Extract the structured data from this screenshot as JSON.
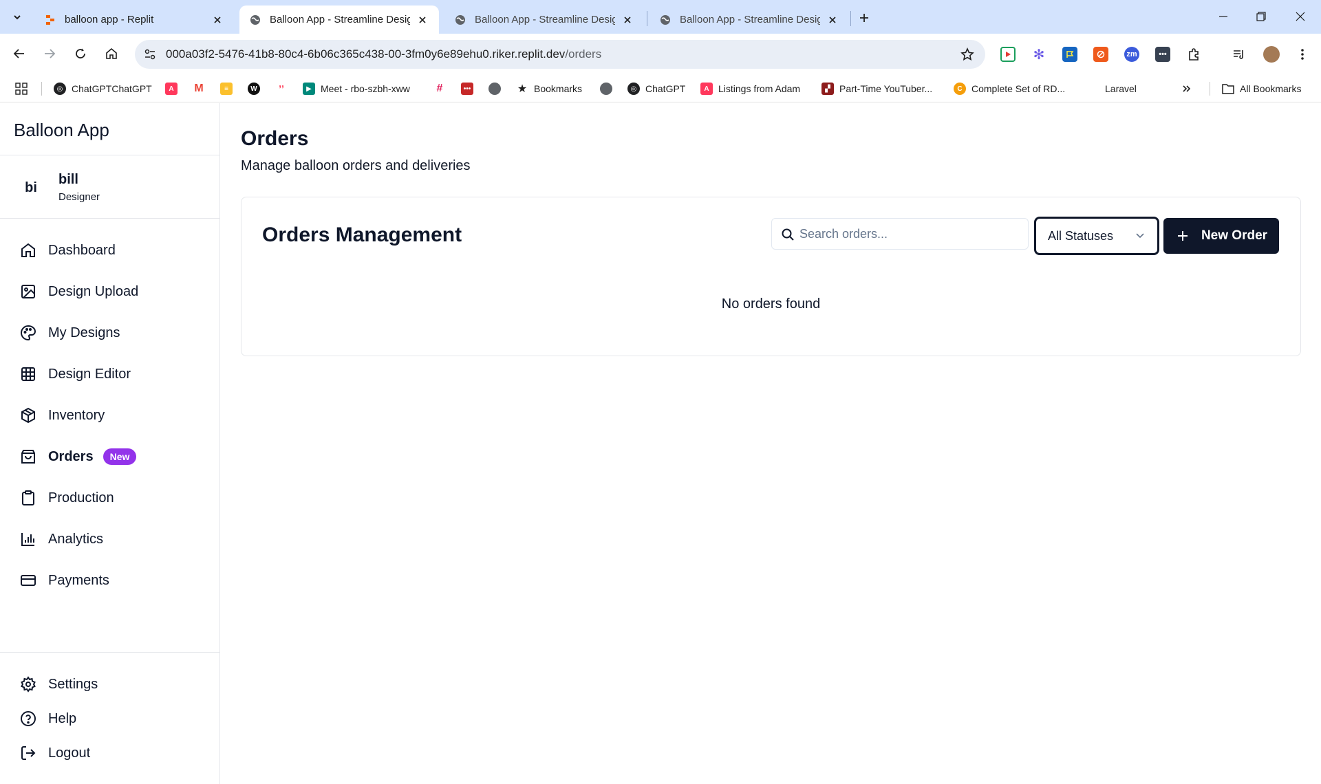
{
  "browser": {
    "tabs": [
      {
        "title": "balloon app - Replit",
        "active": false
      },
      {
        "title": "Balloon App - Streamline Design",
        "active": true
      },
      {
        "title": "Balloon App - Streamline Design",
        "active": false
      },
      {
        "title": "Balloon App - Streamline Design",
        "active": false
      }
    ],
    "url_host": "000a03f2-5476-41b8-80c4-6b06c365c438-00-3fm0y6e89ehu0.riker.replit.dev",
    "url_path": "/orders",
    "bookmarks": [
      {
        "label": "ChatGPTChatGPT",
        "icon": "openai-icon"
      },
      {
        "label": "",
        "icon": "airbnb-icon"
      },
      {
        "label": "",
        "icon": "gmail-icon"
      },
      {
        "label": "",
        "icon": "bookmark-yellow-icon"
      },
      {
        "label": "",
        "icon": "circle-logo-icon"
      },
      {
        "label": "",
        "icon": "monday-icon"
      },
      {
        "label": "Meet - rbo-szbh-xww",
        "icon": "google-meet-icon"
      },
      {
        "label": "",
        "icon": "slack-icon"
      },
      {
        "label": "",
        "icon": "red-grid-icon"
      },
      {
        "label": "",
        "icon": "globe-icon"
      },
      {
        "label": "Bookmarks",
        "icon": "star-icon"
      },
      {
        "label": "",
        "icon": "globe-icon"
      },
      {
        "label": "ChatGPT",
        "icon": "openai-icon"
      },
      {
        "label": "Listings from Adam",
        "icon": "airbnb-icon"
      },
      {
        "label": "Part-Time YouTuber...",
        "icon": "clapper-icon"
      },
      {
        "label": "Complete Set of RD...",
        "icon": "coin-icon"
      },
      {
        "label": "Laravel",
        "icon": ""
      }
    ],
    "all_bookmarks": "All Bookmarks"
  },
  "sidebar": {
    "brand": "Balloon App",
    "user": {
      "initials": "bi",
      "name": "bill",
      "role": "Designer"
    },
    "nav": [
      {
        "label": "Dashboard",
        "icon": "home-icon"
      },
      {
        "label": "Design Upload",
        "icon": "image-icon"
      },
      {
        "label": "My Designs",
        "icon": "palette-icon"
      },
      {
        "label": "Design Editor",
        "icon": "grid-icon"
      },
      {
        "label": "Inventory",
        "icon": "package-icon"
      },
      {
        "label": "Orders",
        "icon": "shopping-bag-icon",
        "badge": "New",
        "active": true
      },
      {
        "label": "Production",
        "icon": "clipboard-icon"
      },
      {
        "label": "Analytics",
        "icon": "bar-chart-icon"
      },
      {
        "label": "Payments",
        "icon": "credit-card-icon"
      }
    ],
    "footer": [
      {
        "label": "Settings",
        "icon": "gear-icon"
      },
      {
        "label": "Help",
        "icon": "help-circle-icon"
      },
      {
        "label": "Logout",
        "icon": "logout-icon"
      }
    ]
  },
  "main": {
    "title": "Orders",
    "subtitle": "Manage balloon orders and deliveries",
    "card": {
      "title": "Orders Management",
      "search": {
        "placeholder": "Search orders...",
        "value": ""
      },
      "status_filter": "All Statuses",
      "new_order_label": "New Order",
      "empty_message": "No orders found"
    }
  },
  "colors": {
    "primary": "#0f172a",
    "badge": "#9333ea",
    "tabbar": "#d3e3fd",
    "omnibox": "#e9eef6"
  }
}
